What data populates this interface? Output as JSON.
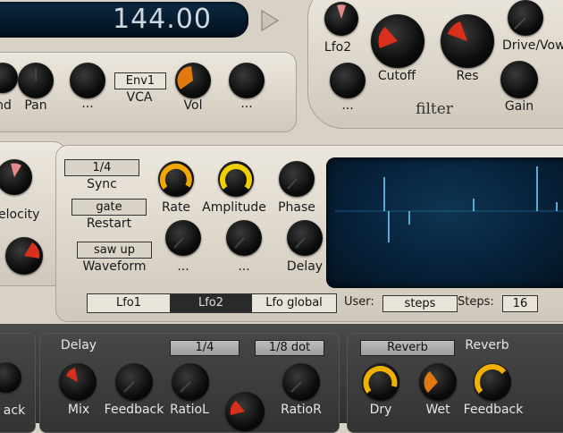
{
  "transport": {
    "tempo": "144.00"
  },
  "vca": {
    "labels": [
      "nd",
      "Pan",
      "...",
      "Vol",
      "..."
    ],
    "env_box": "Env1",
    "title": "VCA"
  },
  "filter": {
    "labels": {
      "lfo2": "Lfo2",
      "cutoff": "Cutoff",
      "res": "Res",
      "drive": "Drive/Vow",
      "gain": "Gain",
      "dots": "..."
    },
    "title": "filter"
  },
  "left_partial": {
    "label": "elocity"
  },
  "lfo": {
    "sync_value": "1/4",
    "sync_label": "Sync",
    "restart_value": "gate",
    "restart_label": "Restart",
    "waveform_value": "saw up",
    "waveform_label": "Waveform",
    "knobs": {
      "rate": "Rate",
      "amplitude": "Amplitude",
      "phase": "Phase",
      "dots1": "...",
      "dots2": "...",
      "delay": "Delay"
    },
    "tabs": [
      "Lfo1",
      "Lfo2",
      "Lfo global"
    ],
    "active_tab": "Lfo2",
    "user_label": "User:",
    "user_value": "steps",
    "steps_label": "Steps:",
    "steps_value": "16"
  },
  "delay": {
    "title": "Delay",
    "ratio_l_value": "1/4",
    "ratio_r_value": "1/8 dot",
    "labels": {
      "mix": "Mix",
      "feedback": "Feedback",
      "ratio_l": "RatioL",
      "ratio_r": "RatioR"
    }
  },
  "reverb": {
    "box_value": "Reverb",
    "title": "Reverb",
    "labels": {
      "dry": "Dry",
      "wet": "Wet",
      "feedback": "Feedback"
    }
  },
  "left_bottom": {
    "label": "ack"
  },
  "colors": {
    "accent_orange": "#e07a10",
    "accent_red": "#d8301c",
    "accent_yellow": "#f0c000",
    "display_blue": "#0a2a4a"
  }
}
